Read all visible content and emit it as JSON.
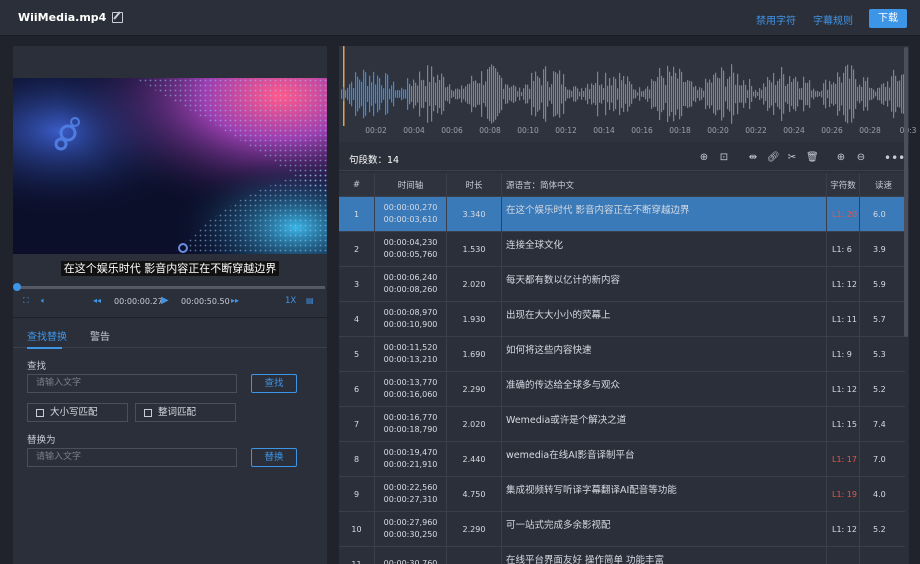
{
  "header": {
    "filename": "WiiMedia.mp4",
    "link_forbidden": "禁用字符",
    "link_rules": "字幕规则",
    "download": "下载"
  },
  "player": {
    "subtitle": "在这个娱乐时代 影音内容正在不断穿越边界",
    "current_time": "00:00:00.27",
    "total_time": "00:00:50.50",
    "speed": "1X",
    "progress": 0.005
  },
  "find": {
    "tab_find": "查找替换",
    "tab_warn": "警告",
    "find_label": "查找",
    "find_placeholder": "请输入文字",
    "find_btn": "查找",
    "case_label": "大小写匹配",
    "word_label": "整词匹配",
    "replace_label": "替换为",
    "replace_placeholder": "请输入文字",
    "replace_btn": "替换"
  },
  "waveform": {
    "ticks": [
      "00:02",
      "00:04",
      "00:06",
      "00:08",
      "00:10",
      "00:12",
      "00:14",
      "00:16",
      "00:18",
      "00:20",
      "00:22",
      "00:24",
      "00:26",
      "00:28",
      "00:3"
    ]
  },
  "table": {
    "segment_count": "句段数：14",
    "headers": {
      "num": "#",
      "time": "时间轴",
      "dur": "时长",
      "text": "源语言：简体中文",
      "chars": "字符数",
      "speed": "读速"
    },
    "rows": [
      {
        "n": "1",
        "start": "00:00:00,270",
        "end": "00:00:03,610",
        "dur": "3.340",
        "text": "在这个娱乐时代 影音内容正在不断穿越边界",
        "chars": "L1: 20",
        "warn": true,
        "speed": "6.0"
      },
      {
        "n": "2",
        "start": "00:00:04,230",
        "end": "00:00:05,760",
        "dur": "1.530",
        "text": "连接全球文化",
        "chars": "L1: 6",
        "warn": false,
        "speed": "3.9"
      },
      {
        "n": "3",
        "start": "00:00:06,240",
        "end": "00:00:08,260",
        "dur": "2.020",
        "text": "每天都有数以亿计的新内容",
        "chars": "L1: 12",
        "warn": false,
        "speed": "5.9"
      },
      {
        "n": "4",
        "start": "00:00:08,970",
        "end": "00:00:10,900",
        "dur": "1.930",
        "text": "出现在大大小小的荧幕上",
        "chars": "L1: 11",
        "warn": false,
        "speed": "5.7"
      },
      {
        "n": "5",
        "start": "00:00:11,520",
        "end": "00:00:13,210",
        "dur": "1.690",
        "text": "如何将这些内容快速",
        "chars": "L1: 9",
        "warn": false,
        "speed": "5.3"
      },
      {
        "n": "6",
        "start": "00:00:13,770",
        "end": "00:00:16,060",
        "dur": "2.290",
        "text": "准确的传达给全球多与观众",
        "chars": "L1: 12",
        "warn": false,
        "speed": "5.2"
      },
      {
        "n": "7",
        "start": "00:00:16,770",
        "end": "00:00:18,790",
        "dur": "2.020",
        "text": "Wemedia或许是个解决之道",
        "chars": "L1: 15",
        "warn": false,
        "speed": "7.4"
      },
      {
        "n": "8",
        "start": "00:00:19,470",
        "end": "00:00:21,910",
        "dur": "2.440",
        "text": "wemedia在线AI影音译制平台",
        "chars": "L1: 17",
        "warn": true,
        "speed": "7.0"
      },
      {
        "n": "9",
        "start": "00:00:22,560",
        "end": "00:00:27,310",
        "dur": "4.750",
        "text": "集成视频转写听译字幕翻译AI配音等功能",
        "chars": "L1: 19",
        "warn": true,
        "speed": "4.0"
      },
      {
        "n": "10",
        "start": "00:00:27,960",
        "end": "00:00:30,250",
        "dur": "2.290",
        "text": "可一站式完成多余影视配",
        "chars": "L1: 12",
        "warn": false,
        "speed": "5.2"
      },
      {
        "n": "11",
        "start": "00:00:30,760",
        "end": "",
        "dur": "",
        "text": "在线平台界面友好 操作简单 功能丰富",
        "chars": "",
        "warn": false,
        "speed": ""
      }
    ]
  },
  "colors": {
    "accent": "#3d95e8",
    "warn": "#e2574c",
    "selected_row": "#3a7ab8"
  }
}
